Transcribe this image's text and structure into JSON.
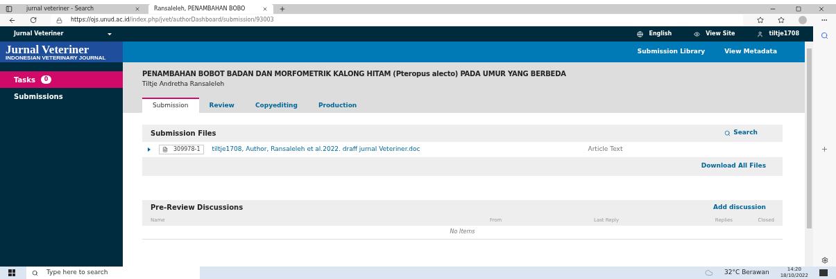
{
  "browser": {
    "tabs": [
      {
        "label": "jurnal veteriner - Search",
        "selected": false
      },
      {
        "label": "Ransaleleh, PENAMBAHAN BOBO",
        "selected": true
      }
    ],
    "url_host": "https://ojs.unud.ac.id",
    "url_path": "/index.php/jvet/authorDashboard/submission/93003"
  },
  "topbar": {
    "journal": "Jurnal Veteriner",
    "links": [
      {
        "kind": "globe",
        "label": "English"
      },
      {
        "kind": "eye",
        "label": "View Site"
      },
      {
        "kind": "user",
        "label": "tiltje1708"
      }
    ]
  },
  "logo": {
    "title": "Jurnal Veteriner",
    "subtitle": "INDONESIAN VETERINARY JOURNAL"
  },
  "sidebar": {
    "items": [
      {
        "label": "Tasks",
        "badge": "0",
        "selected": true
      },
      {
        "label": "Submissions",
        "selected": false
      }
    ]
  },
  "header_links": [
    "Submission Library",
    "View Metadata"
  ],
  "submission": {
    "title": "PENAMBAHAN BOBOT BADAN DAN MORFOMETRIK KALONG HITAM (Pteropus alecto) PADA UMUR YANG BERBEDA",
    "author": "Tiltje Andretha Ransaleleh"
  },
  "tabs": [
    {
      "label": "Submission",
      "selected": true
    },
    {
      "label": "Review",
      "selected": false
    },
    {
      "label": "Copyediting",
      "selected": false
    },
    {
      "label": "Production",
      "selected": false
    }
  ],
  "files_panel": {
    "title": "Submission Files",
    "search": "Search",
    "files": [
      {
        "id": "309978-1",
        "name": "tiltje1708, Author, Ransaleleh et al.2022. draff jurnal Veteriner.doc",
        "type": "Article Text"
      }
    ],
    "download": "Download All Files"
  },
  "discussions_panel": {
    "title": "Pre-Review Discussions",
    "action": "Add discussion",
    "columns": [
      "Name",
      "From",
      "Last Reply",
      "Replies",
      "Closed"
    ],
    "empty": "No Items"
  },
  "taskbar": {
    "search": "Type here to search",
    "weather": "32°C  Berawan",
    "time": "14:20",
    "date": "18/10/2022"
  }
}
